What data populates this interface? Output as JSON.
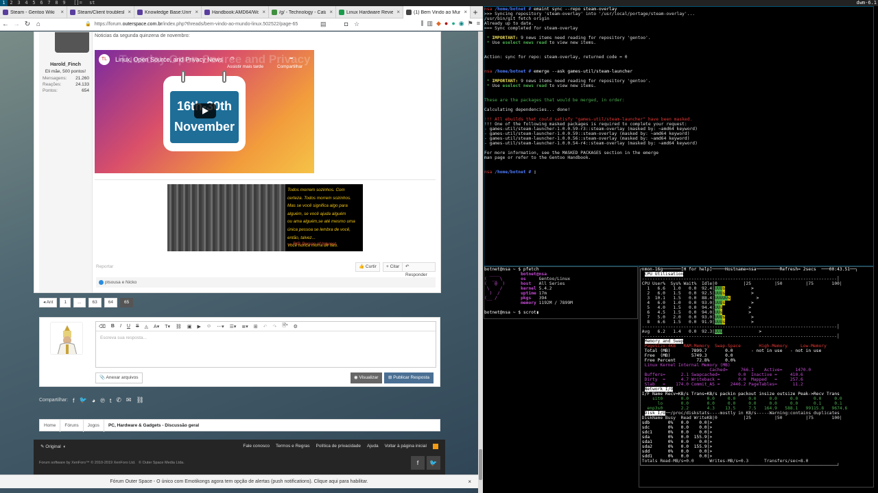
{
  "dwm": {
    "tags": [
      "1",
      "2",
      "3",
      "4",
      "5",
      "6",
      "7",
      "8",
      "9"
    ],
    "layout": "[]=",
    "title": "st",
    "status": "dwm-6.1"
  },
  "browser": {
    "tabs": [
      {
        "label": "Steam - Gentoo Wiki",
        "color": "#5a3e9e"
      },
      {
        "label": "Steam/Client troublesh",
        "color": "#5a3e9e"
      },
      {
        "label": "Knowledge Base:Unm",
        "color": "#5a3e9e"
      },
      {
        "label": "Handbook:AMD64/Wo",
        "color": "#5a3e9e"
      },
      {
        "label": "/g/ - Technology - Cata",
        "color": "#3f8f3f"
      },
      {
        "label": "Linux Hardware Revie",
        "color": "#1a9b4b"
      },
      {
        "label": "(1) Bem Vindo ao Mun",
        "color": "#444444"
      }
    ],
    "new_tab": "+",
    "url": {
      "scheme": "https://forum.",
      "domain": "outerspace.com.br",
      "path": "/index.php?threads/bem-vindo-ao-mundo-linux.502522/page-65"
    }
  },
  "post": {
    "text": "Noticias da segunda quinzena de novembro:",
    "user": {
      "name": "Harold_Finch",
      "title": "Eli mãe, 500 pontos!",
      "stats": [
        {
          "label": "Mensagens:",
          "value": "21.260"
        },
        {
          "label": "Reações:",
          "value": "24.133"
        },
        {
          "label": "Pontos:",
          "value": "654"
        }
      ]
    },
    "video": {
      "channel": "TL",
      "title": "Linux, Open Source, and Privacy News",
      "bg_title": "Tuesday Open Source and Privacy News",
      "watch_later": "Assistir mais tarde",
      "share": "Compartilhar",
      "cal_line1": "16th-30th",
      "cal_line2": "November"
    },
    "meme": {
      "lines": [
        "Todos morrem sozinhos. Com",
        "certeza. Todos morrem sozinhos.",
        "Mas se você significa algo para",
        "alguém, se você ajuda alguém",
        "ou ama alguém,se até mesmo uma",
        "única pessoa se lembra de você,",
        "então, talvez...",
        "Você nunca morra de fato."
      ],
      "author": "— RIP, Person of Interest"
    },
    "report": "Reportar",
    "actions": {
      "like": "Curtir",
      "quote": "+ Citar",
      "reply": "Responder"
    },
    "reactions": {
      "users": "ptsousa e Nicko"
    }
  },
  "pager": {
    "prev": "◂ Ant",
    "pages": [
      "1",
      "...",
      "63",
      "64",
      "65"
    ],
    "current": "65"
  },
  "reply": {
    "placeholder": "Escreva sua resposta...",
    "attach": "Anexar arquivos",
    "preview": "Visualizar",
    "submit": "Publicar Resposta"
  },
  "share": {
    "label": "Compartilhar:"
  },
  "breadcrumb": [
    "Home",
    "Fóruns",
    "Jogos",
    "PC, Hardware & Gadgets - Discussão geral"
  ],
  "footer": {
    "style": "Original",
    "links": [
      "Fale conosco",
      "Termos e Regras",
      "Política de privacidade",
      "Ajuda",
      "Voltar à página inicial"
    ],
    "copyright": "Forum software by XenForo™ © 2010-2019 XenForo Ltd.",
    "copyright2": "© Outer Space Media Ltda."
  },
  "notice": {
    "text": "Fórum Outer Space - O único com Emotikongs agora tem opção de alertas (push notifications). Clique aqui para habilitar.",
    "close": "×"
  },
  "terminal1": {
    "prompt_user": "nsa",
    "prompt_path": "/home/botnet #",
    "cmd1": "emaint sync --repo steam-overlay",
    "out1": [
      ">>> Syncing repository 'steam-overlay' into '/usr/local/portage/steam-overlay'...",
      "/usr/bin/git fetch origin",
      "Already up to date.",
      "=== Sync completed for steam-overlay"
    ],
    "important_label": "IMPORTANT:",
    "important_text": "9 news items need reading for repository 'gentoo'.",
    "use_text": "Use",
    "eselect": "eselect news read",
    "view_text": "to view new items.",
    "action_line": "Action: sync for repo: steam-overlay, returned code = 0",
    "cmd2": "emerge --ask games-util/steam-launcher",
    "packages_line": "These are the packages that would be merged, in order:",
    "calc_line": "Calculating dependencies... done!",
    "masked_line": "!!! All ebuilds that could satisfy \"games-util/steam-launcher\" have been masked.",
    "masked_lines": [
      "!!! One of the following masked packages is required to complete your request:",
      "- games-util/steam-launcher-1.0.0.59-r3::steam-overlay (masked by: ~amd64 keyword)",
      "- games-util/steam-launcher-1.0.0.59::steam-overlay (masked by: ~amd64 keyword)",
      "- games-util/steam-launcher-1.0.0.56::steam-overlay (masked by: ~amd64 keyword)",
      "- games-util/steam-launcher-1.0.0.54-r4::steam-overlay (masked by: ~amd64 keyword)"
    ],
    "info_lines": [
      "For more information, see the MASKED PACKAGES section in the emerge",
      "man page or refer to the Gentoo Handbook."
    ]
  },
  "terminal2": {
    "prompt": "botnet@nsa ~ $",
    "cmd1": "pfetch",
    "cmd2": "scrot",
    "userhost": "botnet@nsa",
    "rows": [
      {
        "k": "os",
        "v": "Gentoo/Linux"
      },
      {
        "k": "host",
        "v": "All Series"
      },
      {
        "k": "kernel",
        "v": "5.4.2"
      },
      {
        "k": "uptime",
        "v": "17m"
      },
      {
        "k": "pkgs",
        "v": "394"
      },
      {
        "k": "memory",
        "v": "1192M / 7899M"
      }
    ]
  },
  "terminal3": {
    "title": "nmon-16g",
    "help": "[H for help]",
    "hostname": "Hostname=nsa",
    "refresh": "Refresh= 2secs",
    "time": "00:43.51",
    "cpu_header": "CPU Utilisation",
    "cpu_cols": "CPU User%  Sys% Wait%  Idle|0          |25         |50         |75       100|",
    "cpu": [
      {
        "n": "1",
        "u": "6.6",
        "s": "1.0",
        "w": "0.0",
        "i": "92.4"
      },
      {
        "n": "2",
        "u": "6.0",
        "s": "1.5",
        "w": "0.0",
        "i": "92.5"
      },
      {
        "n": "3",
        "u": "10.1",
        "s": "1.5",
        "w": "0.0",
        "i": "88.4"
      },
      {
        "n": "4",
        "u": "6.0",
        "s": "1.0",
        "w": "0.0",
        "i": "93.0"
      },
      {
        "n": "5",
        "u": "4.0",
        "s": "1.5",
        "w": "0.0",
        "i": "94.4"
      },
      {
        "n": "6",
        "u": "4.5",
        "s": "1.5",
        "w": "0.0",
        "i": "94.0"
      },
      {
        "n": "7",
        "u": "5.0",
        "s": "2.0",
        "w": "0.0",
        "i": "93.0"
      },
      {
        "n": "8",
        "u": "6.6",
        "s": "1.5",
        "w": "0.0",
        "i": "91.9"
      }
    ],
    "cpu_avg": "Avg   6.2   1.4   0.0  92.3",
    "mem_header": "Memory and Swap",
    "mem_lines": [
      "PageSize:4KB   RAM-Memory  Swap-Space       High-Memory     Low-Memory",
      "Total (MB)        7899.7       0.0       - not in use   - not in use",
      "Free  (MB)        5749.3       0.0",
      "Free Percent        72.8%      0.0%"
    ],
    "kern_lines": [
      "Linux Kernel Internal Memory (MB)",
      "                         Cached=     766.1    Active=     1470.0",
      "Buffers=      2.1 Swapcached=       0.0  Inactive =     410.6",
      "Dirty  =      4.7 Writeback =       0.0  Mapped   =     257.6",
      "Slab   =    174.0 Commit_AS =    2446.2 PageTables=      11.2"
    ],
    "net_header": "Network I/O",
    "net_lines": [
      "I/F Name Recv=KB/s Trans=KB/s packin packout insize outsize Peak->Recv Trans",
      "    sit0       0.0       0.0     0.0     0.0     0.0     0.0      0.0     0.0",
      "      lo       0.0       0.0     0.0     0.0     0.0     0.0      0.1     0.1",
      "  enp3s0       2.2       4.3    13.5     7.5   164.9   588.1   99115.8   9674.6"
    ],
    "disk_header": "Disk I/O",
    "disk_title": "/proc/diskstats----mostly in KB/s-----Warning:contains duplicates",
    "disk_cols": "DiskName Busy  Read WriteKB|0          |25         |50         |75       100|",
    "disks": [
      {
        "n": "sdb",
        "b": "0%",
        "r": "0.0",
        "w": "0.0"
      },
      {
        "n": "sdc",
        "b": "0%",
        "r": "0.0",
        "w": "0.0"
      },
      {
        "n": "sdc1",
        "b": "0%",
        "r": "0.0",
        "w": "0.0"
      },
      {
        "n": "sda",
        "b": "0%",
        "r": "0.0",
        "w": "155.9"
      },
      {
        "n": "sda1",
        "b": "0%",
        "r": "0.0",
        "w": "0.0"
      },
      {
        "n": "sda2",
        "b": "0%",
        "r": "0.0",
        "w": "155.9"
      },
      {
        "n": "sdd",
        "b": "0%",
        "r": "0.0",
        "w": "0.0"
      },
      {
        "n": "sdd1",
        "b": "0%",
        "r": "0.0",
        "w": "0.0"
      }
    ],
    "disk_total": "Totals Read-MB/s=0.0      Writes-MB/s=0.3      Transfers/sec=8.0"
  }
}
